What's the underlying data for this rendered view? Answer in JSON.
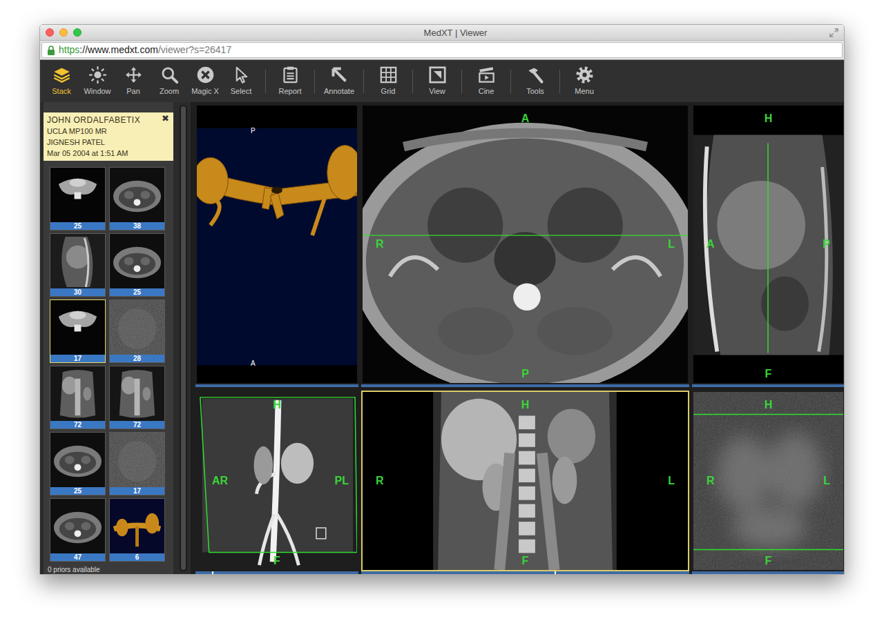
{
  "window": {
    "title": "MedXT | Viewer",
    "url": {
      "scheme": "https",
      "host": "://www.medxt.com",
      "path": "/viewer?s=26417"
    }
  },
  "toolbar": {
    "groups": [
      [
        {
          "label": "Stack",
          "selected": true
        },
        {
          "label": "Window",
          "selected": false
        },
        {
          "label": "Pan",
          "selected": false
        },
        {
          "label": "Zoom",
          "selected": false
        },
        {
          "label": "Magic X",
          "selected": false
        },
        {
          "label": "Select",
          "selected": false
        }
      ],
      [
        {
          "label": "Report",
          "selected": false
        }
      ],
      [
        {
          "label": "Annotate",
          "selected": false
        }
      ],
      [
        {
          "label": "Grid",
          "selected": false
        }
      ],
      [
        {
          "label": "View",
          "selected": false
        }
      ],
      [
        {
          "label": "Cine",
          "selected": false
        }
      ],
      [
        {
          "label": "Tools",
          "selected": false
        }
      ],
      [
        {
          "label": "Menu",
          "selected": false
        }
      ]
    ]
  },
  "sidebar": {
    "patient": {
      "name": "JOHN ORDALFABETIX",
      "institution": "UCLA MP100 MR",
      "physician": "JIGNESH PATEL",
      "date": "Mar 05 2004 at 1:51 AM",
      "close": "✖"
    },
    "series": [
      {
        "count": "25",
        "selected": false,
        "kind": "mip"
      },
      {
        "count": "38",
        "selected": false,
        "kind": "axial"
      },
      {
        "count": "30",
        "selected": false,
        "kind": "sagittal"
      },
      {
        "count": "25",
        "selected": false,
        "kind": "axial"
      },
      {
        "count": "17",
        "selected": true,
        "kind": "mip"
      },
      {
        "count": "28",
        "selected": false,
        "kind": "noise"
      },
      {
        "count": "72",
        "selected": false,
        "kind": "coronal"
      },
      {
        "count": "72",
        "selected": false,
        "kind": "coronal"
      },
      {
        "count": "25",
        "selected": false,
        "kind": "axial"
      },
      {
        "count": "17",
        "selected": false,
        "kind": "noise"
      },
      {
        "count": "47",
        "selected": false,
        "kind": "axial"
      },
      {
        "count": "6",
        "selected": false,
        "kind": "volume"
      }
    ],
    "footer": "0 priors available"
  },
  "viewports": [
    {
      "kind": "volume",
      "selected": false,
      "labels": {
        "top": "P",
        "bottom": "A"
      }
    },
    {
      "kind": "axial",
      "selected": false,
      "labels": {
        "top": "A",
        "bottom": "P",
        "left": "R",
        "right": "L"
      }
    },
    {
      "kind": "sagittal",
      "selected": false,
      "labels": {
        "top": "H",
        "bottom": "F",
        "left": "A",
        "right": "P"
      }
    },
    {
      "kind": "mip",
      "selected": false,
      "slice": 0.1,
      "labels": {
        "top": "H",
        "bottom": "F",
        "left": "AR",
        "right": "PL"
      }
    },
    {
      "kind": "coronal",
      "selected": true,
      "slice": 0.59,
      "labels": {
        "top": "H",
        "bottom": "F",
        "left": "R",
        "right": "L"
      }
    },
    {
      "kind": "perfusion",
      "selected": false,
      "labels": {
        "top": "H",
        "bottom": "F",
        "left": "R",
        "right": "L"
      }
    }
  ]
}
